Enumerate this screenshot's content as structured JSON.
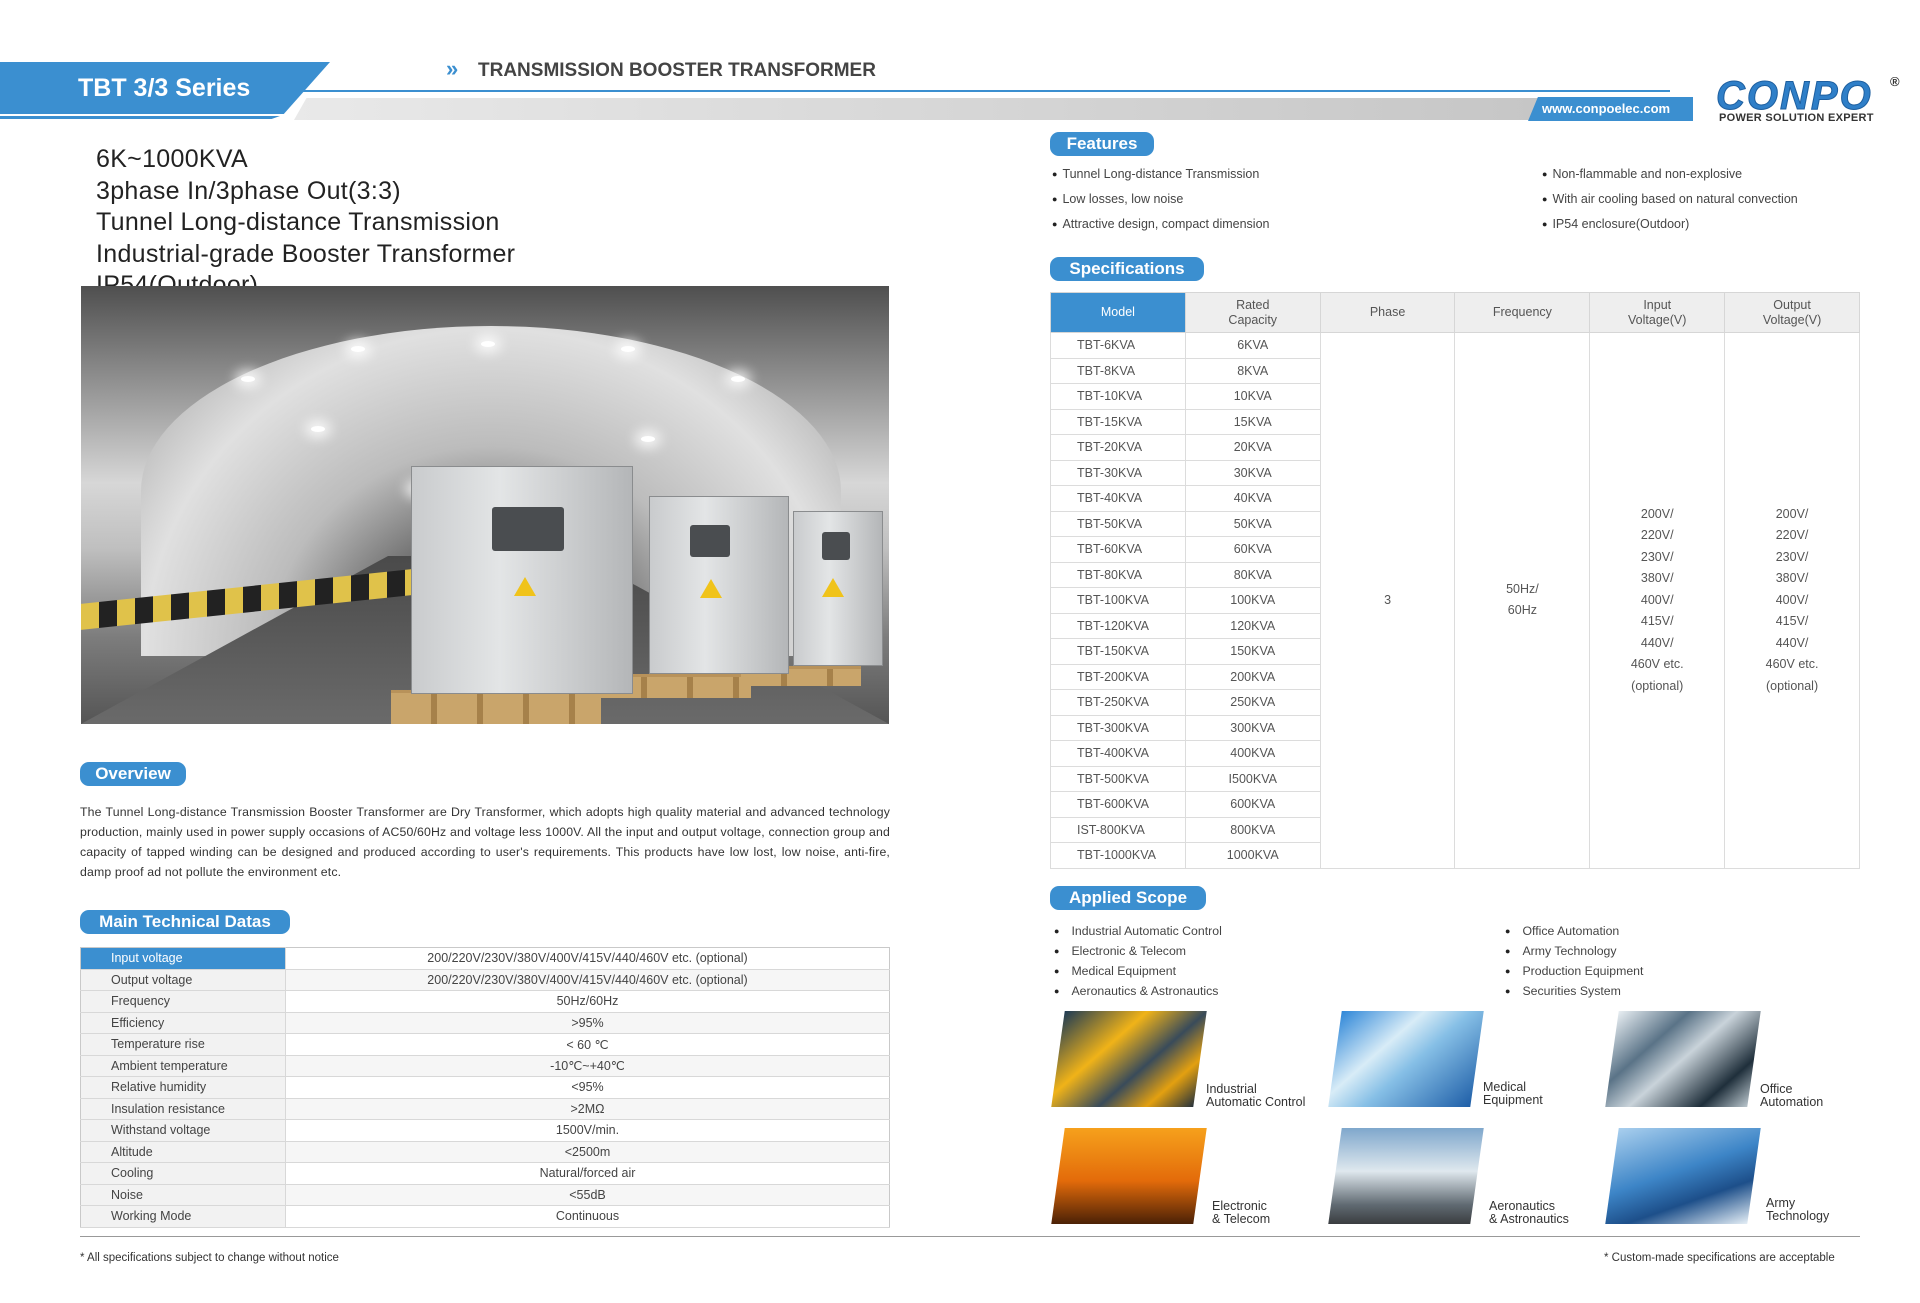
{
  "header": {
    "series": "TBT 3/3 Series",
    "arrow": "»",
    "title": "TRANSMISSION BOOSTER TRANSFORMER",
    "url": "www.conpoelec.com",
    "logo": "CONPO",
    "logo_reg": "®",
    "logo_tagline": "POWER SOLUTION EXPERT"
  },
  "headline": [
    "6K~1000KVA",
    "3phase In/3phase Out(3:3)",
    "Tunnel Long-distance Transmission",
    "Industrial-grade Booster Transformer",
    "IP54(Outdoor)"
  ],
  "overview": {
    "heading": "Overview",
    "text": "The Tunnel Long-distance Transmission Booster Transformer are Dry Transformer, which adopts high quality material and advanced technology production, mainly used in power supply occasions of AC50/60Hz and voltage less 1000V.  All the input and output voltage, connection group and capacity of tapped winding can be designed and produced according to user's requirements. This products have low lost, low noise, anti-fire, damp proof ad not pollute the environment etc."
  },
  "main_tech": {
    "heading": "Main Technical Datas",
    "rows": [
      {
        "k": "Input voltage",
        "v": "200/220V/230V/380V/400V/415V/440/460V etc. (optional)"
      },
      {
        "k": "Output voltage",
        "v": "200/220V/230V/380V/400V/415V/440/460V etc. (optional)"
      },
      {
        "k": "Frequency",
        "v": "50Hz/60Hz"
      },
      {
        "k": "Efficiency",
        "v": ">95%"
      },
      {
        "k": "Temperature rise",
        "v": "< 60 ℃"
      },
      {
        "k": "Ambient temperature",
        "v": "-10℃~+40℃"
      },
      {
        "k": "Relative humidity",
        "v": "<95%"
      },
      {
        "k": "Insulation resistance",
        "v": ">2MΩ"
      },
      {
        "k": "Withstand voltage",
        "v": "1500V/min."
      },
      {
        "k": "Altitude",
        "v": "<2500m"
      },
      {
        "k": "Cooling",
        "v": "Natural/forced air"
      },
      {
        "k": "Noise",
        "v": "<55dB"
      },
      {
        "k": "Working Mode",
        "v": "Continuous"
      }
    ]
  },
  "features": {
    "heading": "Features",
    "left": [
      "Tunnel Long-distance Transmission",
      "Low losses, low noise",
      "Attractive design, compact dimension"
    ],
    "right": [
      "Non-flammable and non-explosive",
      "With air cooling based on natural convection",
      "IP54 enclosure(Outdoor)"
    ]
  },
  "specs": {
    "heading": "Specifications",
    "headers": {
      "model": "Model",
      "capacity_1": "Rated",
      "capacity_2": "Capacity",
      "phase": "Phase",
      "frequency": "Frequency",
      "input_1": "Input",
      "input_2": "Voltage(V)",
      "output_1": "Output",
      "output_2": "Voltage(V)"
    },
    "rows": [
      {
        "model": "TBT-6KVA",
        "cap": "6KVA"
      },
      {
        "model": "TBT-8KVA",
        "cap": "8KVA"
      },
      {
        "model": "TBT-10KVA",
        "cap": "10KVA"
      },
      {
        "model": "TBT-15KVA",
        "cap": "15KVA"
      },
      {
        "model": "TBT-20KVA",
        "cap": "20KVA"
      },
      {
        "model": "TBT-30KVA",
        "cap": "30KVA"
      },
      {
        "model": "TBT-40KVA",
        "cap": "40KVA"
      },
      {
        "model": "TBT-50KVA",
        "cap": "50KVA"
      },
      {
        "model": "TBT-60KVA",
        "cap": "60KVA"
      },
      {
        "model": "TBT-80KVA",
        "cap": "80KVA"
      },
      {
        "model": "TBT-100KVA",
        "cap": "100KVA"
      },
      {
        "model": "TBT-120KVA",
        "cap": "120KVA"
      },
      {
        "model": "TBT-150KVA",
        "cap": "150KVA"
      },
      {
        "model": "TBT-200KVA",
        "cap": "200KVA"
      },
      {
        "model": "TBT-250KVA",
        "cap": "250KVA"
      },
      {
        "model": "TBT-300KVA",
        "cap": "300KVA"
      },
      {
        "model": "TBT-400KVA",
        "cap": "400KVA"
      },
      {
        "model": "TBT-500KVA",
        "cap": "I500KVA"
      },
      {
        "model": "TBT-600KVA",
        "cap": "600KVA"
      },
      {
        "model": "IST-800KVA",
        "cap": "800KVA"
      },
      {
        "model": "TBT-1000KVA",
        "cap": "1000KVA"
      }
    ],
    "phase": "3",
    "frequency": [
      "50Hz/",
      "60Hz"
    ],
    "input_voltage": [
      "200V/",
      "220V/",
      "230V/",
      "380V/",
      "400V/",
      "415V/",
      "440V/",
      "460V etc.",
      "(optional)"
    ],
    "output_voltage": [
      "200V/",
      "220V/",
      "230V/",
      "380V/",
      "400V/",
      "415V/",
      "440V/",
      "460V etc.",
      "(optional)"
    ]
  },
  "scope": {
    "heading": "Applied Scope",
    "left": [
      "Industrial Automatic Control",
      "Electronic & Telecom",
      "Medical Equipment",
      "Aeronautics & Astronautics"
    ],
    "right": [
      "Office Automation",
      "Army Technology",
      "Production Equipment",
      "Securities System"
    ],
    "tiles": [
      {
        "l1": "Industrial",
        "l2": "Automatic Control"
      },
      {
        "l1": "Medical",
        "l2": "Equipment"
      },
      {
        "l1": "Office",
        "l2": "Automation"
      },
      {
        "l1": "Electronic",
        "l2": "& Telecom"
      },
      {
        "l1": "Aeronautics",
        "l2": "& Astronautics"
      },
      {
        "l1": "Army",
        "l2": "Technology"
      }
    ]
  },
  "footer": {
    "left": "* All specifications subject to change without notice",
    "right": "* Custom-made specifications are acceptable"
  }
}
